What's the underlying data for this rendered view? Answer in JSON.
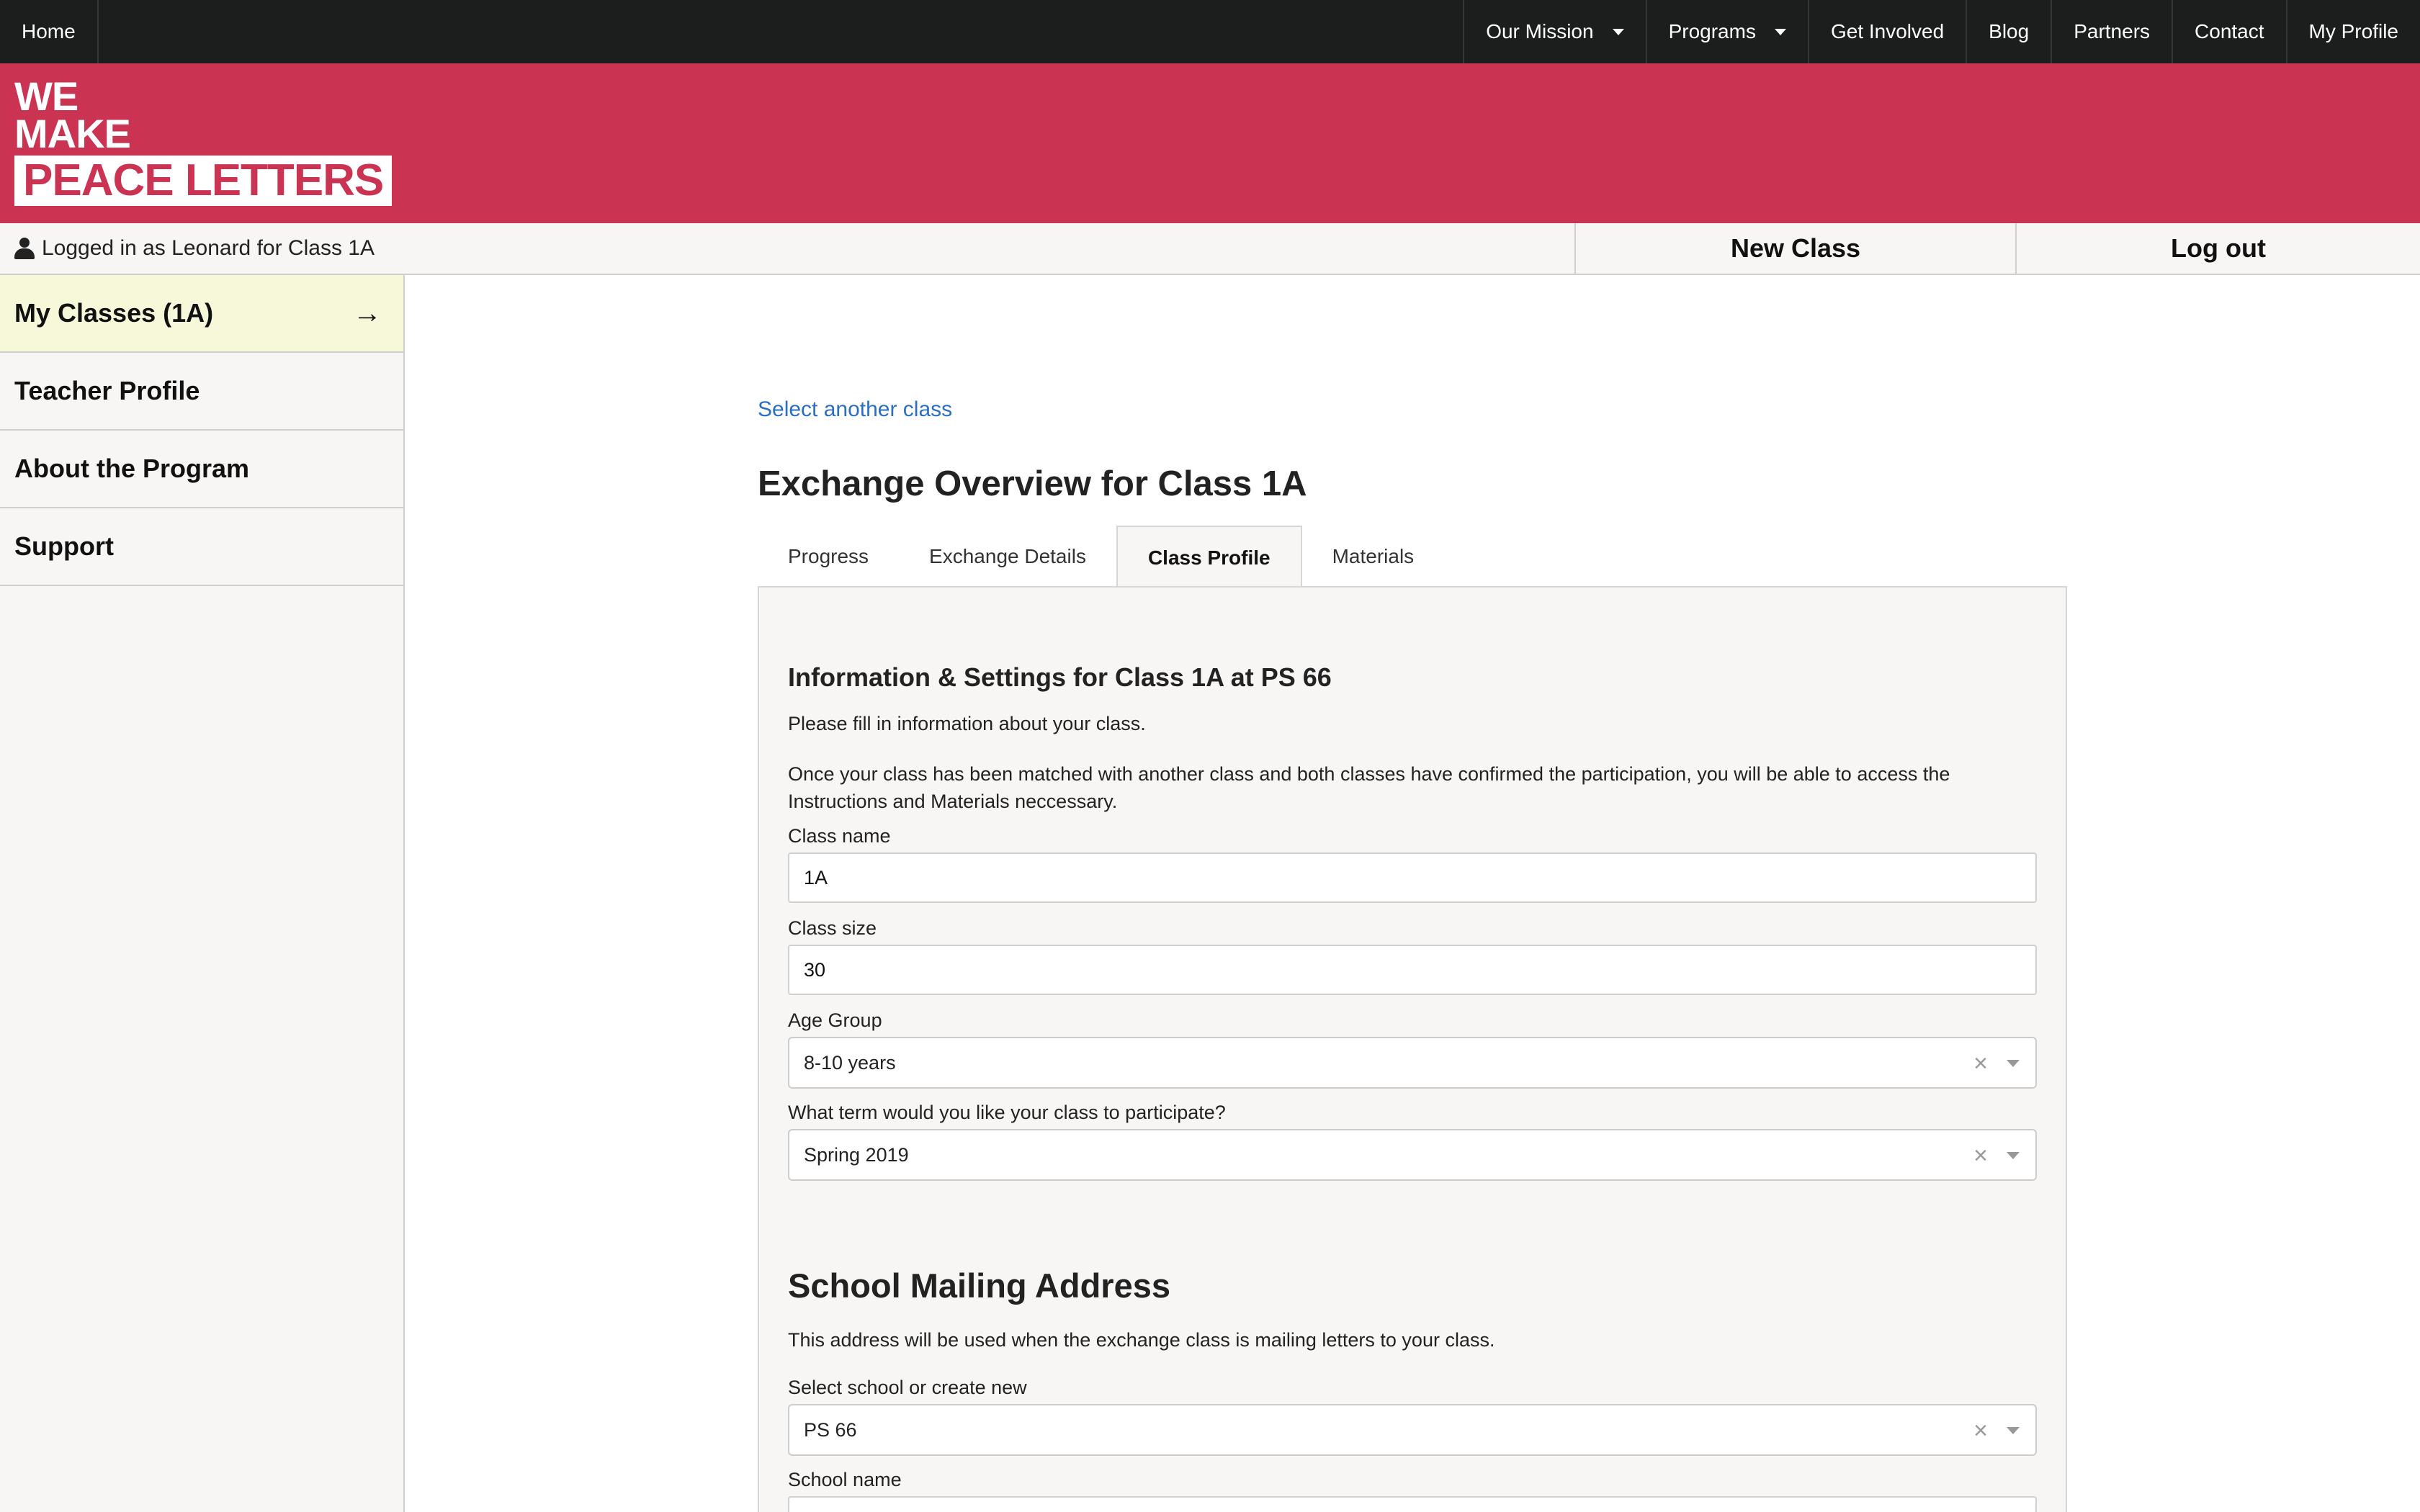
{
  "topnav": {
    "home": "Home",
    "items": [
      {
        "label": "Our Mission",
        "dropdown": true
      },
      {
        "label": "Programs",
        "dropdown": true
      },
      {
        "label": "Get Involved",
        "dropdown": false
      },
      {
        "label": "Blog",
        "dropdown": false
      },
      {
        "label": "Partners",
        "dropdown": false
      },
      {
        "label": "Contact",
        "dropdown": false
      },
      {
        "label": "My Profile",
        "dropdown": false
      }
    ]
  },
  "brand": {
    "line1": "WE",
    "line2": "MAKE",
    "line3": "PEACE LETTERS",
    "color": "#cb3352"
  },
  "statusbar": {
    "logged_in_text": "Logged in as Leonard for Class 1A",
    "new_class": "New Class",
    "log_out": "Log out"
  },
  "sidebar": {
    "items": [
      {
        "label": "My Classes (1A)",
        "active": true,
        "icon": "arrow-right-icon"
      },
      {
        "label": "Teacher Profile",
        "active": false
      },
      {
        "label": "About the Program",
        "active": false
      },
      {
        "label": "Support",
        "active": false
      }
    ]
  },
  "main": {
    "select_link": "Select another class",
    "title": "Exchange Overview for Class 1A",
    "tabs": [
      {
        "label": "Progress",
        "active": false
      },
      {
        "label": "Exchange Details",
        "active": false
      },
      {
        "label": "Class Profile",
        "active": true
      },
      {
        "label": "Materials",
        "active": false
      }
    ]
  },
  "panel": {
    "heading": "Information & Settings for Class 1A at PS 66",
    "intro": "Please fill in information about your class.",
    "notice": "Once your class has been matched with another class and both classes have confirmed the participation, you will be able to access the Instructions and Materials neccessary.",
    "class_name": {
      "label": "Class name",
      "value": "1A"
    },
    "class_size": {
      "label": "Class size",
      "value": "30"
    },
    "age_group": {
      "label": "Age Group",
      "value": "8-10 years"
    },
    "term": {
      "label": "What term would you like your class to participate?",
      "value": "Spring 2019"
    },
    "address_heading": "School Mailing Address",
    "address_note": "This address will be used when the exchange class is mailing letters to your class.",
    "school_select": {
      "label": "Select school or create new",
      "value": "PS 66"
    },
    "school_name": {
      "label": "School name"
    }
  },
  "colors": {
    "topnav_bg": "#1c1d1d",
    "brand_bg": "#cb3352",
    "link": "#2a6fc4",
    "active_sidebar": "#f7f7d9",
    "panel_bg": "#f7f6f4"
  }
}
